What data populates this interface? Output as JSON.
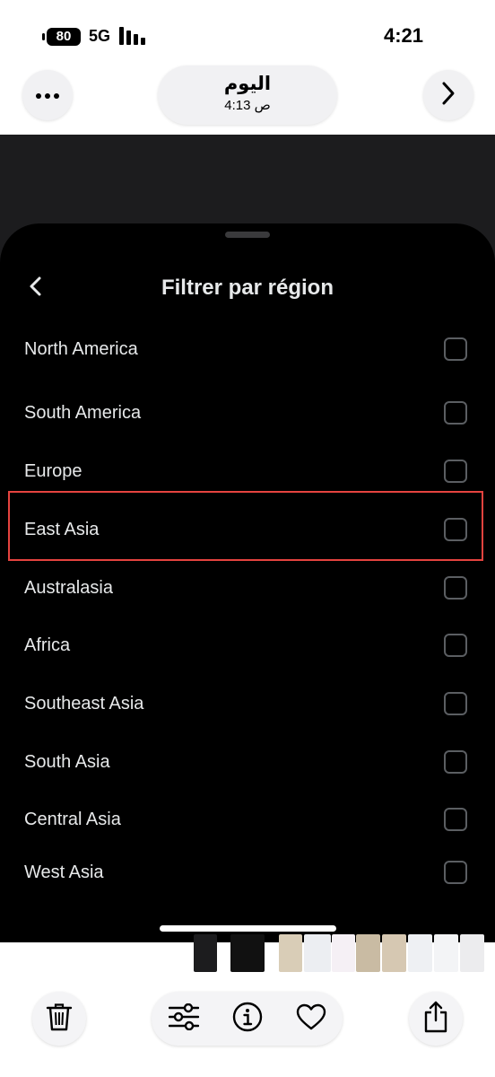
{
  "status_bar": {
    "battery": "80",
    "network": "5G",
    "time": "4:21"
  },
  "nav": {
    "title": "اليوم",
    "subtitle": "4:13 ص",
    "more_icon": "ellipsis-icon",
    "next_icon": "chevron-right-icon"
  },
  "sheet": {
    "title": "Filtrer par région",
    "back_icon": "chevron-left-icon",
    "regions": [
      {
        "label": "North America",
        "checked": false
      },
      {
        "label": "South America",
        "checked": false
      },
      {
        "label": "Europe",
        "checked": false
      },
      {
        "label": "East Asia",
        "checked": false
      },
      {
        "label": "Australasia",
        "checked": false
      },
      {
        "label": "Africa",
        "checked": false
      },
      {
        "label": "Southeast Asia",
        "checked": false
      },
      {
        "label": "South Asia",
        "checked": false
      },
      {
        "label": "Central Asia",
        "checked": false
      },
      {
        "label": "West Asia",
        "checked": false
      }
    ],
    "highlighted_region": "East Asia",
    "highlight_color": "#e5433f"
  },
  "toolbar": {
    "icons": [
      "trash-icon",
      "sliders-icon",
      "info-icon",
      "heart-icon",
      "share-icon"
    ]
  },
  "colors": {
    "sheet_bg": "#000000",
    "text": "#e7e9ea",
    "checkbox_border": "#5b5e62"
  }
}
